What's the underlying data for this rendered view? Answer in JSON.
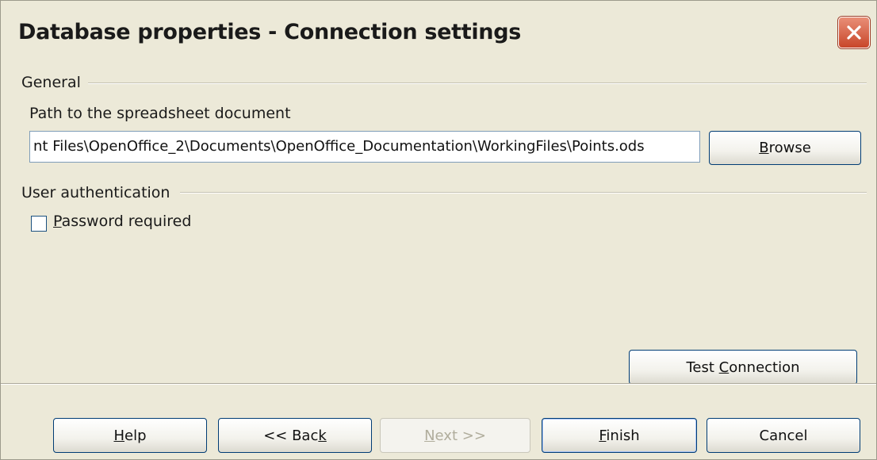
{
  "window": {
    "title": "Database properties - Connection settings",
    "close_icon": "close-icon",
    "accent": "#d0522f"
  },
  "general": {
    "section_label": "General",
    "path_label": "Path to the spreadsheet document",
    "path_value": "nt Files\\OpenOffice_2\\Documents\\OpenOffice_Documentation\\WorkingFiles\\Points.ods",
    "browse_label": "Browse",
    "browse_mnemonic": "B"
  },
  "auth": {
    "section_label": "User authentication",
    "password_required_label": "Password required",
    "password_required_mnemonic": "P",
    "password_required_checked": false
  },
  "test_connection_label": "Test Connection",
  "footer": {
    "help_label": "Help",
    "back_label": "<< Back",
    "next_label": "Next >>",
    "finish_label": "Finish",
    "cancel_label": "Cancel"
  }
}
